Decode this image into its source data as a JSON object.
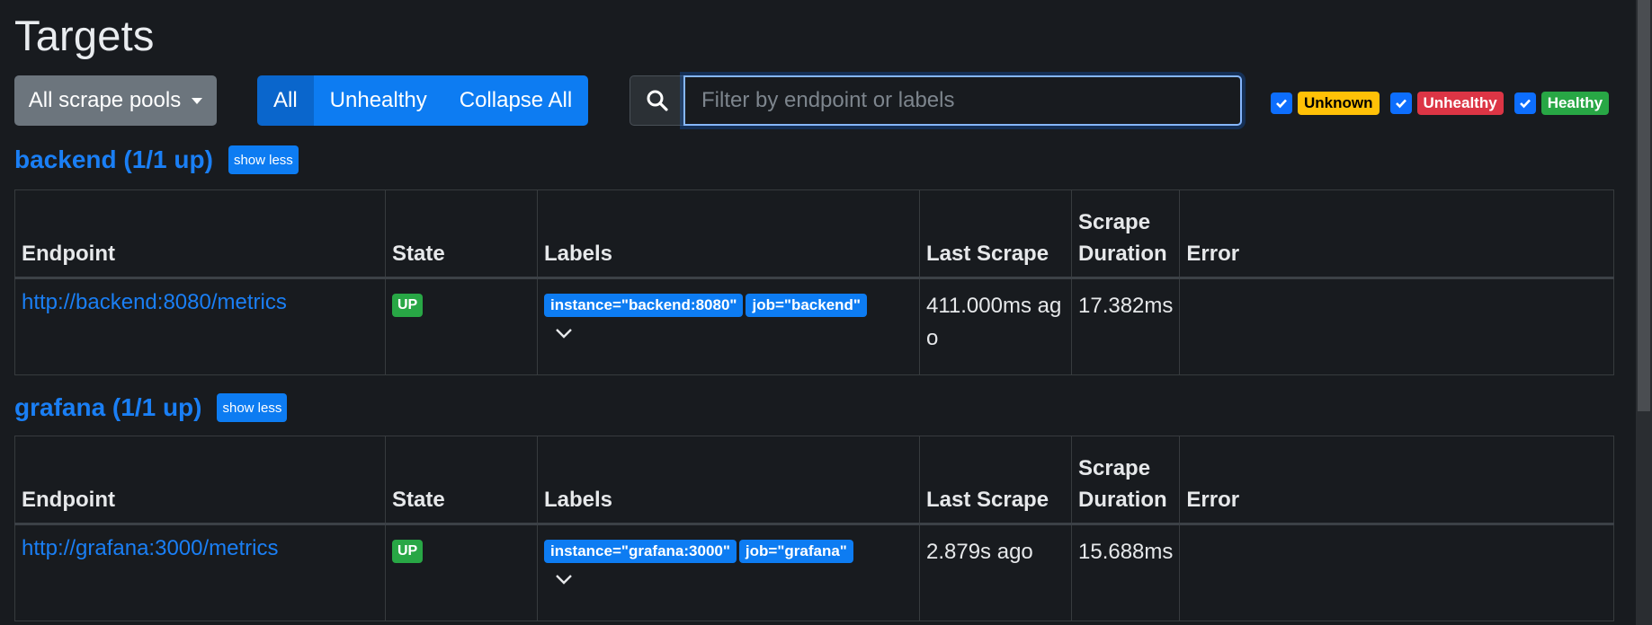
{
  "page": {
    "title": "Targets"
  },
  "toolbar": {
    "pool_select": "All scrape pools",
    "btn_all": "All",
    "btn_unhealthy": "Unhealthy",
    "btn_collapse": "Collapse All",
    "search_placeholder": "Filter by endpoint or labels"
  },
  "filters": {
    "unknown": "Unknown",
    "unhealthy": "Unhealthy",
    "healthy": "Healthy",
    "colors": {
      "unknown": "#ffc107",
      "unhealthy": "#dc3545",
      "healthy": "#28a745"
    }
  },
  "columns": {
    "endpoint": "Endpoint",
    "state": "State",
    "labels": "Labels",
    "last_scrape": "Last Scrape",
    "scrape": "Scrape",
    "duration": "Duration",
    "error": "Error"
  },
  "pools": [
    {
      "title": "backend (1/1 up)",
      "toggle": "show less",
      "rows": [
        {
          "endpoint": "http://backend:8080/metrics",
          "state": "UP",
          "labels": [
            "instance=\"backend:8080\"",
            "job=\"backend\""
          ],
          "last_scrape": "411.000ms ago",
          "duration": "17.382ms",
          "error": ""
        }
      ]
    },
    {
      "title": "grafana (1/1 up)",
      "toggle": "show less",
      "rows": [
        {
          "endpoint": "http://grafana:3000/metrics",
          "state": "UP",
          "labels": [
            "instance=\"grafana:3000\"",
            "job=\"grafana\""
          ],
          "last_scrape": "2.879s ago",
          "duration": "15.688ms",
          "error": ""
        }
      ]
    }
  ],
  "icons": {
    "search": "search-icon",
    "caret": "caret-down-icon",
    "check": "check-icon",
    "chevron": "chevron-down-icon"
  }
}
